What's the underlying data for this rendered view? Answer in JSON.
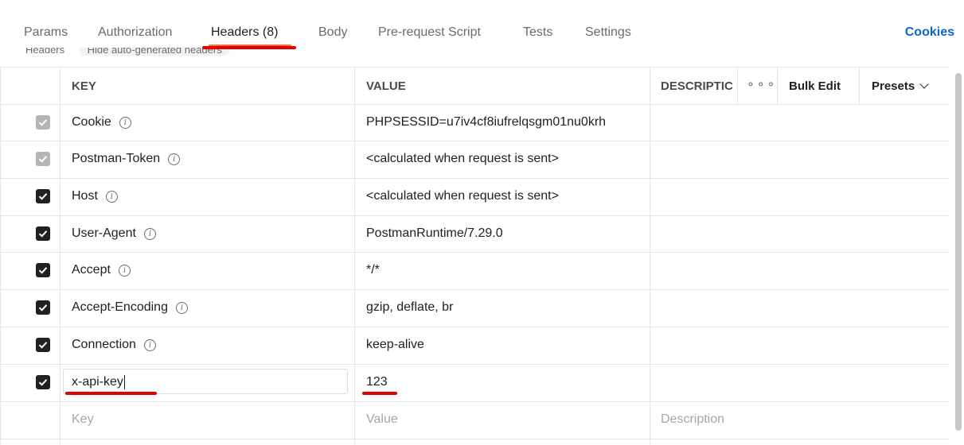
{
  "tabs": {
    "params": "Params",
    "authorization": "Authorization",
    "headers": "Headers (8)",
    "body": "Body",
    "prerequest": "Pre-request Script",
    "tests": "Tests",
    "settings": "Settings"
  },
  "cookies_label": "Cookies",
  "hidden_headers": {
    "label": "Headers",
    "toggle": "Hide auto-generated headers"
  },
  "table": {
    "columns": {
      "key": "KEY",
      "value": "VALUE",
      "description": "DESCRIPTIC"
    },
    "more_icon": "ellipsis-icon",
    "bulk_edit": "Bulk Edit",
    "presets": "Presets",
    "rows": [
      {
        "checked": true,
        "auto": true,
        "key": "Cookie",
        "value": "PHPSESSID=u7iv4cf8iufrelqsgm01nu0krh"
      },
      {
        "checked": true,
        "auto": true,
        "key": "Postman-Token",
        "value": "<calculated when request is sent>"
      },
      {
        "checked": true,
        "auto": false,
        "key": "Host",
        "value": "<calculated when request is sent>"
      },
      {
        "checked": true,
        "auto": false,
        "key": "User-Agent",
        "value": "PostmanRuntime/7.29.0"
      },
      {
        "checked": true,
        "auto": false,
        "key": "Accept",
        "value": "*/*"
      },
      {
        "checked": true,
        "auto": false,
        "key": "Accept-Encoding",
        "value": "gzip, deflate, br"
      },
      {
        "checked": true,
        "auto": false,
        "key": "Connection",
        "value": "keep-alive"
      },
      {
        "checked": true,
        "auto": false,
        "key": "x-api-key",
        "value": "123"
      }
    ],
    "new_row": {
      "key_placeholder": "Key",
      "value_placeholder": "Value",
      "description_placeholder": "Description"
    }
  },
  "colors": {
    "accent": "#ff6c37",
    "link": "#0b66d3",
    "annotation": "#e00000",
    "checkbox_checked": "#212121",
    "checkbox_auto": "#b5b5b5"
  }
}
